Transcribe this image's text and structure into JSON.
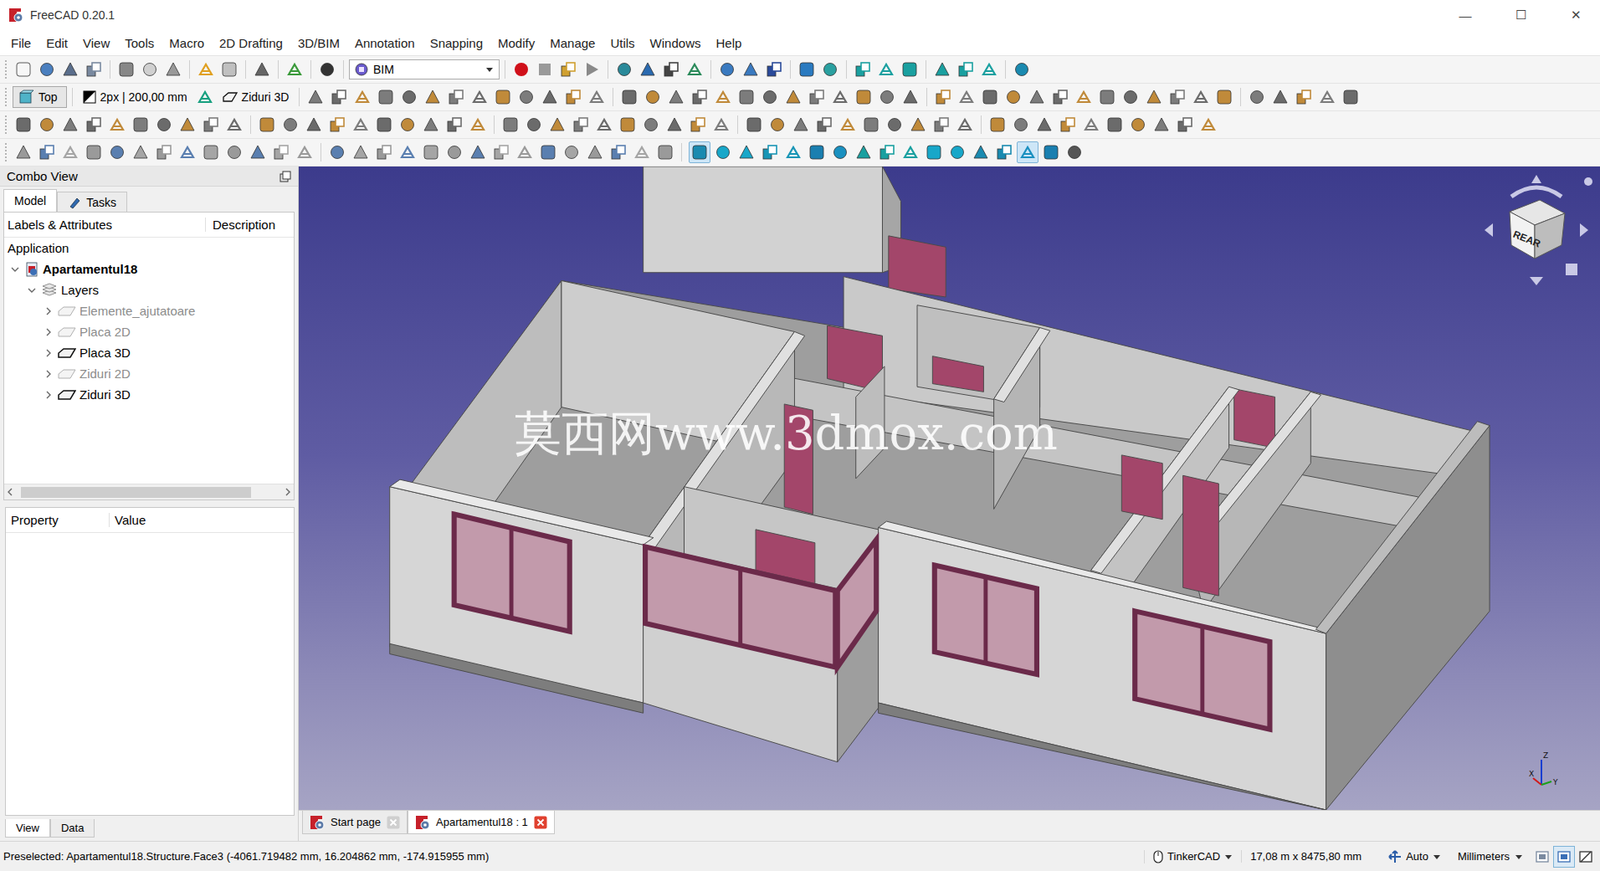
{
  "window": {
    "title": "FreeCAD 0.20.1",
    "controls": [
      "—",
      "☐",
      "✕"
    ]
  },
  "menu": [
    "File",
    "Edit",
    "View",
    "Tools",
    "Macro",
    "2D Drafting",
    "3D/BIM",
    "Annotation",
    "Snapping",
    "Modify",
    "Manage",
    "Utils",
    "Windows",
    "Help"
  ],
  "toolbar": {
    "workbench": "BIM",
    "view_button": "Top",
    "line_style": "2px | 200,00 mm",
    "working_plane": "Ziduri 3D",
    "snaps": [
      {
        "on": true
      },
      {
        "on": false
      },
      {
        "on": false
      },
      {
        "on": false
      },
      {
        "on": false
      },
      {
        "on": false
      },
      {
        "on": false
      },
      {
        "on": false
      },
      {
        "on": false
      },
      {
        "on": false
      },
      {
        "on": false
      },
      {
        "on": false
      },
      {
        "on": false
      },
      {
        "on": false
      },
      {
        "on": true
      },
      {
        "on": false
      },
      {
        "on": false
      }
    ]
  },
  "combo_view": {
    "title": "Combo View",
    "tabs": [
      {
        "label": "Model",
        "selected": true
      },
      {
        "label": "Tasks",
        "selected": false
      }
    ],
    "tree": {
      "columns": [
        "Labels & Attributes",
        "Description"
      ],
      "root": "Application",
      "document": {
        "label": "Apartamentul18",
        "expanded": true
      },
      "group": {
        "label": "Layers",
        "expanded": true
      },
      "items": [
        {
          "label": "Elemente_ajutatoare",
          "visible": false,
          "expanded": false
        },
        {
          "label": "Placa 2D",
          "visible": false,
          "expanded": false
        },
        {
          "label": "Placa 3D",
          "visible": true,
          "expanded": false
        },
        {
          "label": "Ziduri 2D",
          "visible": false,
          "expanded": false
        },
        {
          "label": "Ziduri 3D",
          "visible": true,
          "expanded": false
        }
      ]
    },
    "properties": {
      "columns": [
        "Property",
        "Value"
      ]
    },
    "bottom_tabs": [
      {
        "label": "View",
        "selected": true
      },
      {
        "label": "Data",
        "selected": false
      }
    ]
  },
  "viewport": {
    "watermark": "莫西网www.3dmox.com",
    "nav_cube": "REAR",
    "axes": [
      "Z",
      "X",
      "Y"
    ]
  },
  "doc_tabs": [
    {
      "label": "Start page",
      "selected": false
    },
    {
      "label": "Apartamentul18 : 1",
      "selected": true
    }
  ],
  "status_bar": {
    "message": "Preselected: Apartamentul18.Structure.Face3 (-4061.719482 mm, 16.204862 mm, -174.915955 mm)",
    "navigation": "TinkerCAD",
    "dimensions": "17,08 m x 8475,80 mm",
    "mode": "Auto",
    "units": "Millimeters"
  }
}
